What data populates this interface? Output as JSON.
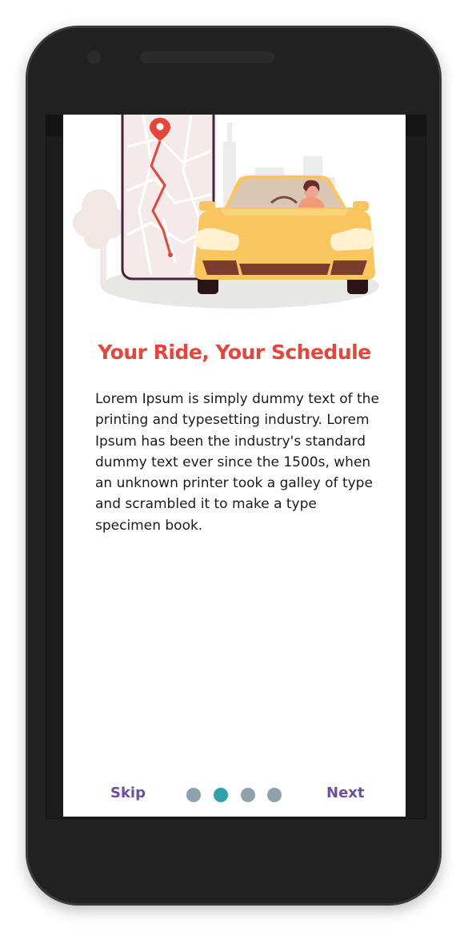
{
  "onboarding": {
    "title": "Your Ride, Your Schedule",
    "description": "Lorem Ipsum is simply dummy text of the printing and typesetting industry. Lorem Ipsum has been the industry's standard dummy text ever since the 1500s, when an unknown printer took a galley of type and scrambled it to make a type specimen book.",
    "illustration": "car-with-map-illustration",
    "page_indicator": {
      "total": 4,
      "current": 2
    }
  },
  "nav": {
    "skip_label": "Skip",
    "next_label": "Next"
  },
  "colors": {
    "title": "#e5453a",
    "nav_text": "#6a4fa2",
    "dot_active": "#2ea2a8",
    "dot_inactive": "#8fa2ac",
    "car_body": "#f8c55f",
    "device_frame": "#212121"
  }
}
